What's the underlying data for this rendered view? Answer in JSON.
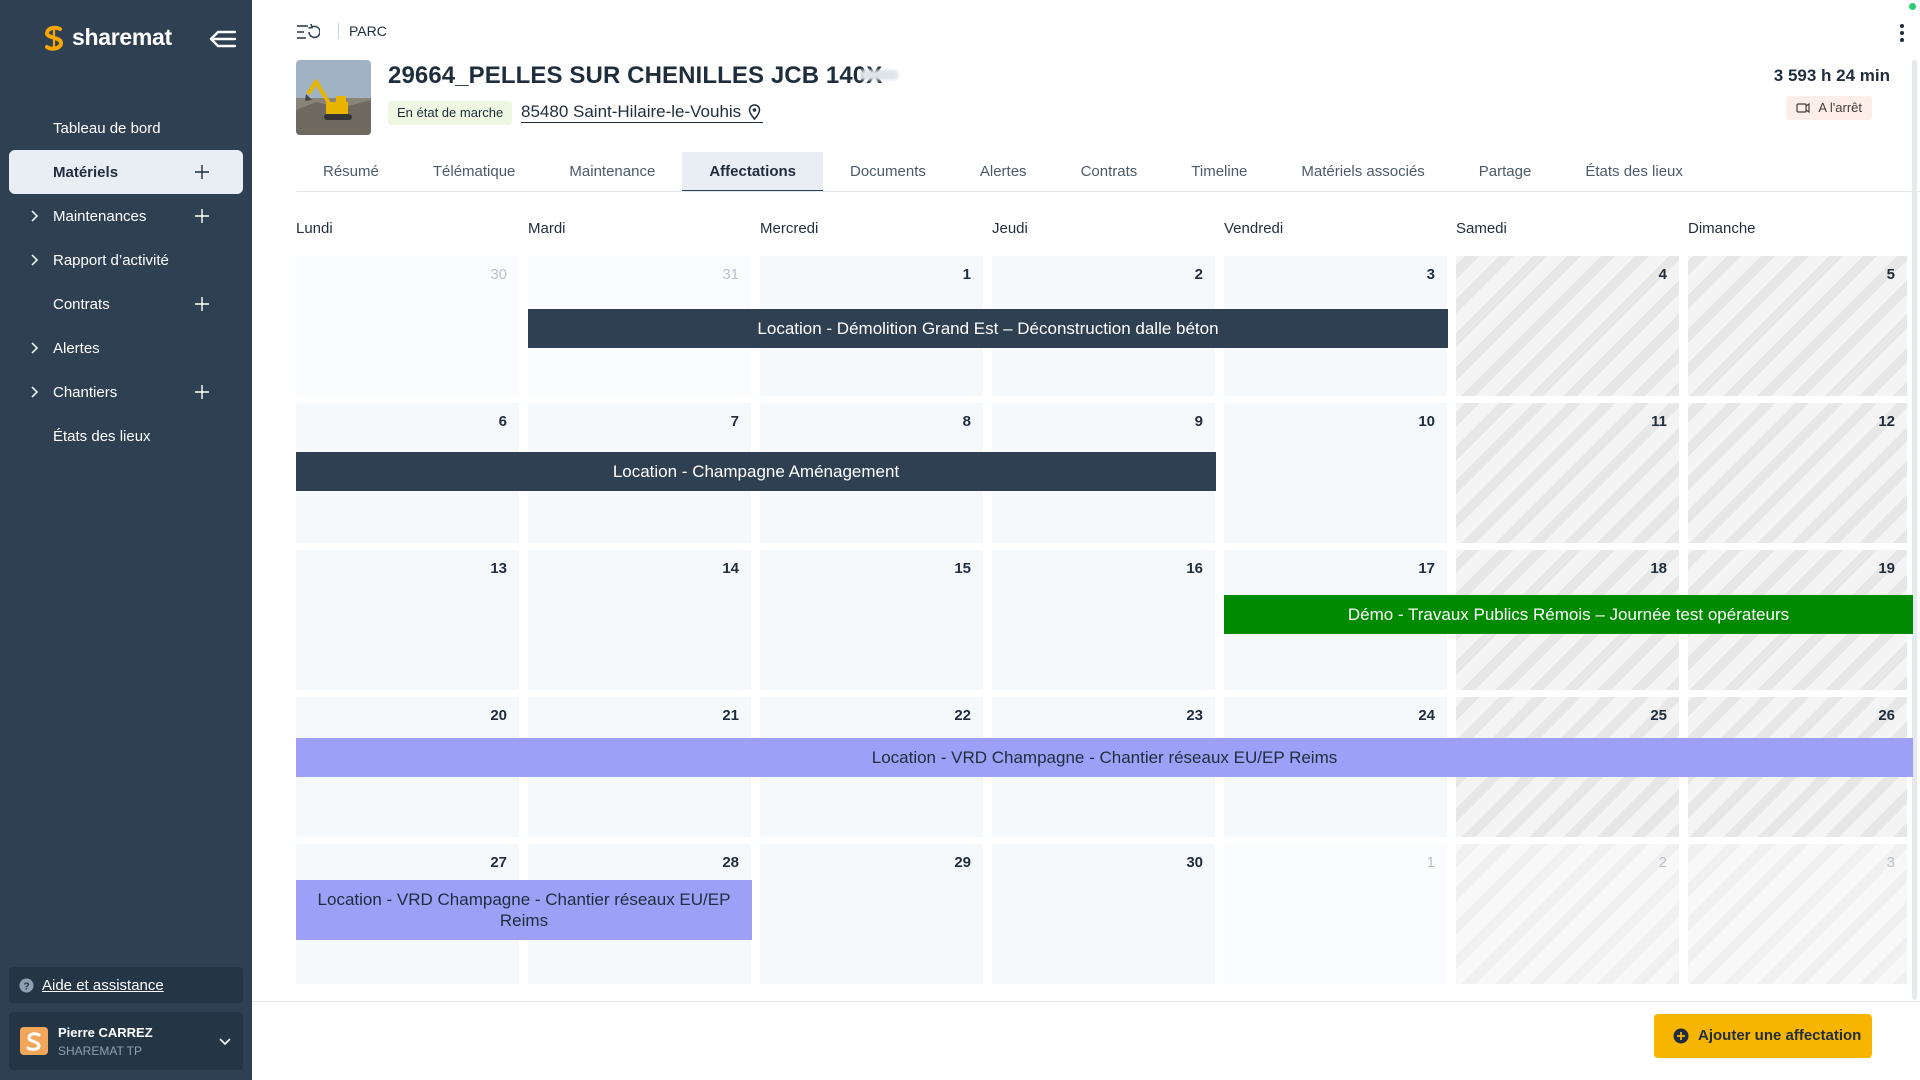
{
  "app": {
    "brand": "sharemat"
  },
  "sidebar": {
    "items": [
      {
        "label": "Tableau de bord"
      },
      {
        "label": "Matériels"
      },
      {
        "label": "Maintenances"
      },
      {
        "label": "Rapport d’activité"
      },
      {
        "label": "Contrats"
      },
      {
        "label": "Alertes"
      },
      {
        "label": "Chantiers"
      },
      {
        "label": "États des lieux"
      }
    ],
    "help": "Aide et assistance",
    "user": {
      "name": "Pierre CARREZ",
      "org": "SHAREMAT TP"
    }
  },
  "header": {
    "breadcrumb": "PARC",
    "title": "29664_PELLES SUR CHENILLES JCB 140X",
    "status": "En état de marche",
    "location": "85480 Saint-Hilaire-le-Vouhis",
    "hours": "3 593 h 24 min",
    "engine_state": "A l'arrêt"
  },
  "tabs": [
    "Résumé",
    "Télématique",
    "Maintenance",
    "Affectations",
    "Documents",
    "Alertes",
    "Contrats",
    "Timeline",
    "Matériels associés",
    "Partage",
    "États des lieux"
  ],
  "calendar": {
    "daynames": [
      "Lundi",
      "Mardi",
      "Mercredi",
      "Jeudi",
      "Vendredi",
      "Samedi",
      "Dimanche"
    ],
    "weeks": [
      [
        "30",
        "31",
        "1",
        "2",
        "3",
        "4",
        "5"
      ],
      [
        "6",
        "7",
        "8",
        "9",
        "10",
        "11",
        "12"
      ],
      [
        "13",
        "14",
        "15",
        "16",
        "17",
        "18",
        "19"
      ],
      [
        "20",
        "21",
        "22",
        "23",
        "24",
        "25",
        "26"
      ],
      [
        "27",
        "28",
        "29",
        "30",
        "1",
        "2",
        "3"
      ]
    ],
    "events": [
      {
        "label": "Location - Démolition Grand Est – Déconstruction dalle béton",
        "color": "#2e4052"
      },
      {
        "label": "Location - Champagne Aménagement",
        "color": "#2e4052"
      },
      {
        "label": "Démo - Travaux Publics Rémois – Journée test opérateurs",
        "color": "#008a00"
      },
      {
        "label": "Location - VRD Champagne - Chantier réseaux EU/EP Reims",
        "color": "#9da0f6"
      },
      {
        "label": "Location - VRD Champagne - Chantier réseaux EU/EP Reims",
        "color": "#9da0f6"
      }
    ]
  },
  "footer": {
    "add_label": "Ajouter une affectation"
  }
}
